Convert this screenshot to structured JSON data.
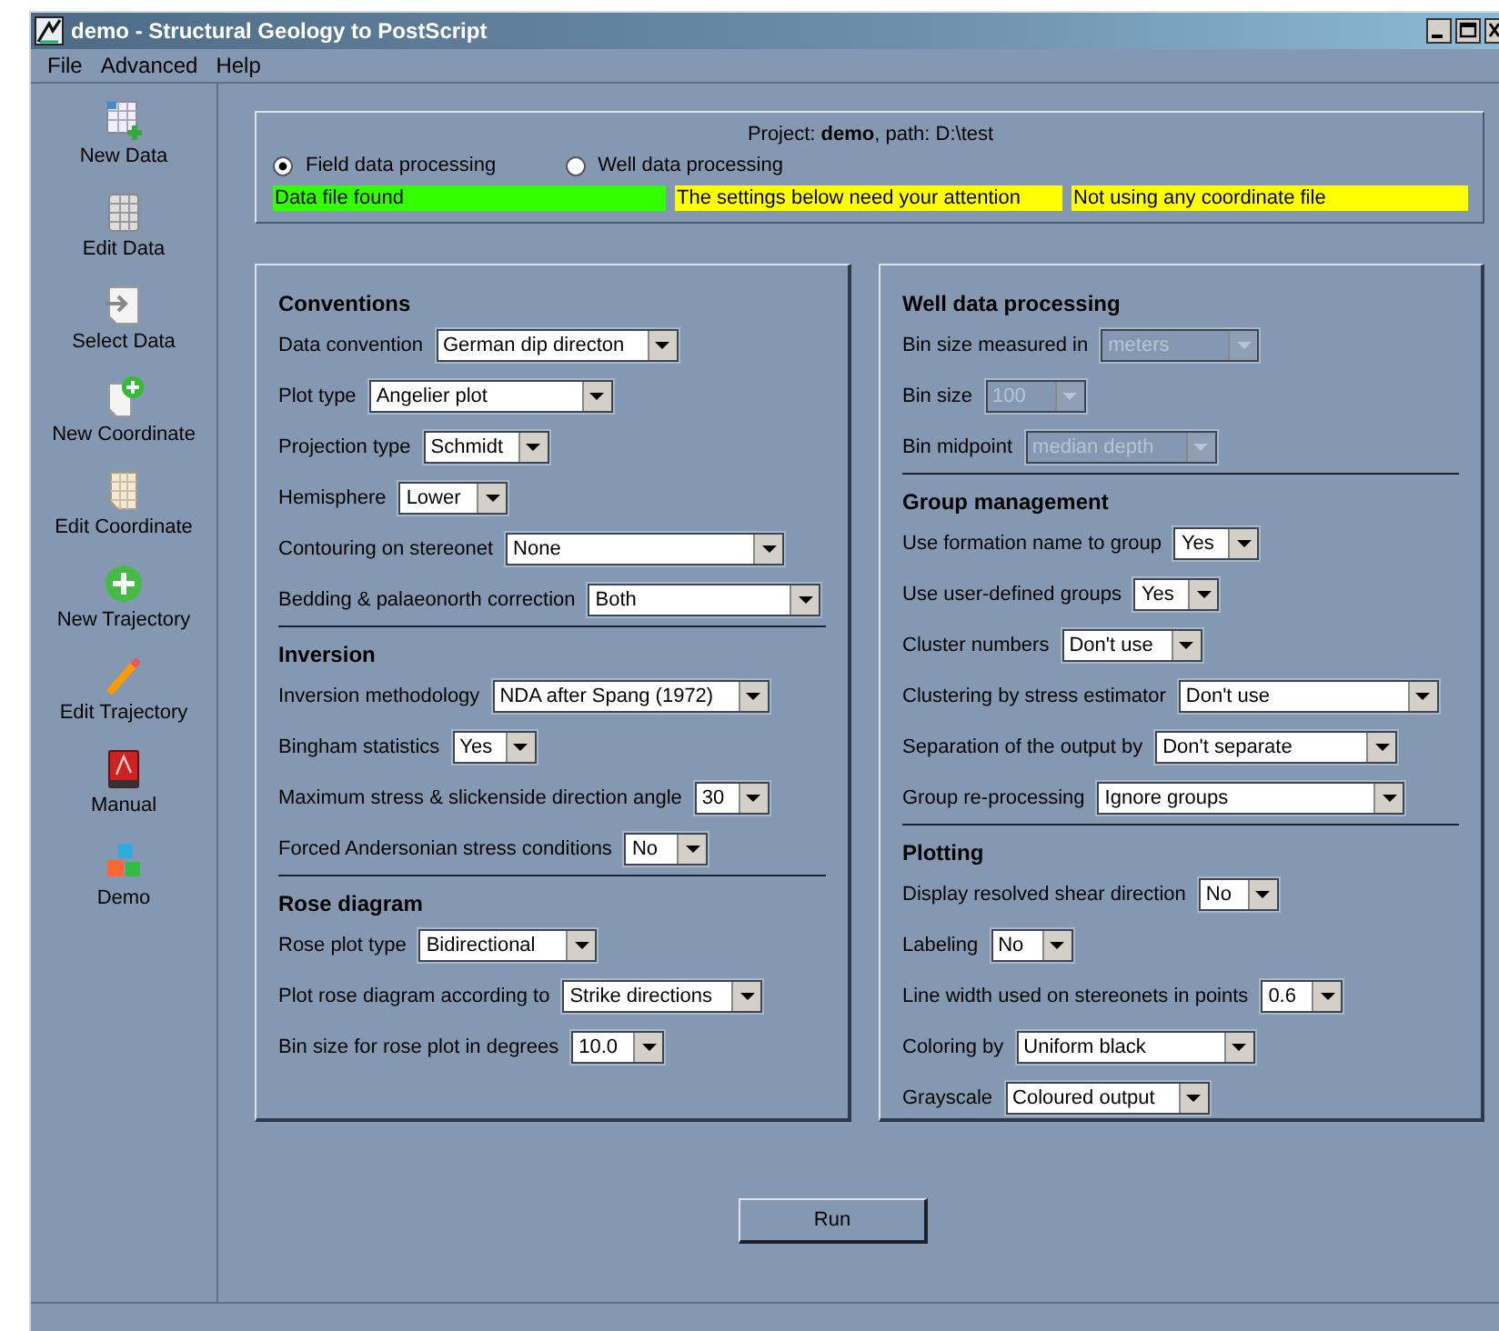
{
  "window": {
    "title": "demo - Structural Geology to PostScript"
  },
  "menu": [
    "File",
    "Advanced",
    "Help"
  ],
  "sidebar": {
    "items": [
      {
        "kind": "new-data",
        "label": "New Data"
      },
      {
        "kind": "edit-data",
        "label": "Edit Data"
      },
      {
        "kind": "select-data",
        "label": "Select Data"
      },
      {
        "kind": "new-coordinate",
        "label": "New Coordinate"
      },
      {
        "kind": "edit-coordinate",
        "label": "Edit Coordinate"
      },
      {
        "kind": "new-trajectory",
        "label": "New Trajectory"
      },
      {
        "kind": "edit-trajectory",
        "label": "Edit Trajectory"
      },
      {
        "kind": "manual",
        "label": "Manual"
      },
      {
        "kind": "demo",
        "label": "Demo"
      }
    ]
  },
  "project": {
    "text": "Project: **demo**, path: D:\\test",
    "modes": [
      {
        "label": "Field data processing",
        "selected": true
      },
      {
        "label": "Well data processing",
        "selected": false
      }
    ],
    "status": [
      {
        "text": "Data file found",
        "color": "#33ff00"
      },
      {
        "text": "The settings below need your attention",
        "color": "#ffff00"
      },
      {
        "text": "Not using any coordinate file",
        "color": "#ffff00"
      }
    ]
  },
  "panels": [
    {
      "sections": [
        {
          "title": "Conventions",
          "rows": [
            {
              "label": "Data convention",
              "value": "German dip directon"
            },
            {
              "label": "Plot type",
              "value": "Angelier plot"
            },
            {
              "label": "Projection type",
              "value": "Schmidt"
            },
            {
              "label": "Hemisphere",
              "value": "Lower"
            },
            {
              "label": "Contouring on stereonet",
              "value": "None"
            },
            {
              "label": "Bedding & palaeonorth correction",
              "value": "Both"
            }
          ]
        },
        {
          "title": "Inversion",
          "rows": [
            {
              "label": "Inversion methodology",
              "value": "NDA after Spang (1972)"
            },
            {
              "label": "Bingham statistics",
              "value": "Yes"
            },
            {
              "label": "Maximum stress & slickenside direction angle",
              "value": "30"
            },
            {
              "label": "Forced Andersonian stress conditions",
              "value": "No"
            }
          ]
        },
        {
          "title": "Rose diagram",
          "rows": [
            {
              "label": "Rose plot type",
              "value": "Bidirectional"
            },
            {
              "label": "Plot rose diagram according to",
              "value": "Strike directions"
            },
            {
              "label": "Bin size for rose plot in degrees",
              "value": "10.0"
            }
          ]
        }
      ]
    },
    {
      "sections": [
        {
          "title": "Well data processing",
          "rows": [
            {
              "label": "Bin size measured in",
              "value": "meters",
              "disabled": true
            },
            {
              "label": "Bin size",
              "value": "100",
              "disabled": true
            },
            {
              "label": "Bin midpoint",
              "value": "median depth",
              "disabled": true
            }
          ]
        },
        {
          "title": "Group management",
          "rows": [
            {
              "label": "Use formation name to group",
              "value": "Yes",
              "disabled": false
            },
            {
              "label": "Use user-defined groups",
              "value": "Yes",
              "disabled": false
            },
            {
              "label": "Cluster numbers",
              "value": "Don't use",
              "disabled": false
            },
            {
              "label": "Clustering by stress estimator",
              "value": "Don't use",
              "disabled": false
            },
            {
              "label": "Separation of the output by",
              "value": "Don't separate",
              "disabled": false
            },
            {
              "label": "Group re-processing",
              "value": "Ignore groups",
              "disabled": false
            }
          ]
        },
        {
          "title": "Plotting",
          "rows": [
            {
              "label": "Display resolved shear direction",
              "value": "No",
              "disabled": false
            },
            {
              "label": "Labeling",
              "value": "No",
              "disabled": false
            },
            {
              "label": "Line width used on stereonets in points",
              "value": "0.6",
              "disabled": false
            },
            {
              "label": "Coloring by",
              "value": "Uniform black",
              "disabled": false
            },
            {
              "label": "Grayscale",
              "value": "Coloured output",
              "disabled": false
            }
          ]
        }
      ]
    }
  ],
  "run_button": "Run"
}
